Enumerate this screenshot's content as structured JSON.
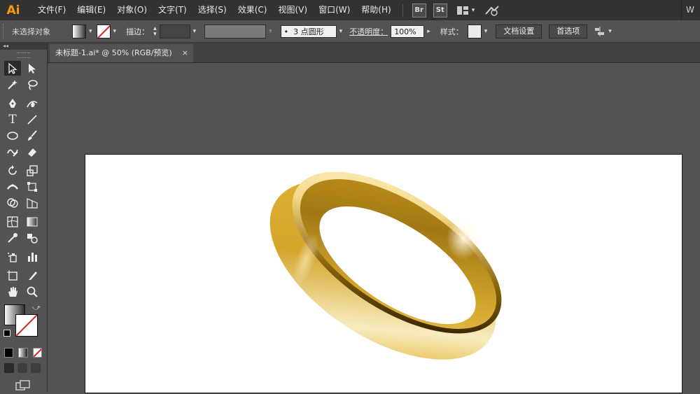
{
  "app": {
    "logo": "Ai",
    "menu": [
      "文件(F)",
      "编辑(E)",
      "对象(O)",
      "文字(T)",
      "选择(S)",
      "效果(C)",
      "视图(V)",
      "窗口(W)",
      "帮助(H)"
    ],
    "badges": [
      "Br",
      "St"
    ],
    "workspace_right": "W"
  },
  "control": {
    "selection_status": "未选择对象",
    "stroke_label": "描边：",
    "brush_label": "3 点圆形",
    "opacity_label": "不透明度：",
    "opacity_value": "100%",
    "style_label": "样式：",
    "doc_setup": "文档设置",
    "preferences": "首选项"
  },
  "toolbox": {
    "collapse_arrows": "◂◂"
  },
  "document": {
    "tab_title": "未标题-1.ai* @ 50% (RGB/预览)",
    "tab_close": "×"
  },
  "colors": {
    "accent": "#ff9a00",
    "ring_gold": "#d6a82c",
    "ring_light": "#fff3c4",
    "ring_dark": "#7a5a0a",
    "none_red": "#e02020"
  },
  "icons": {
    "selection": "selection-tool-icon",
    "direct_selection": "direct-selection-icon",
    "magic_wand": "magic-wand-icon",
    "lasso": "lasso-icon",
    "pen": "pen-icon",
    "curvature": "curvature-icon",
    "type": "type-icon",
    "line": "line-segment-icon",
    "ellipse": "ellipse-icon",
    "paintbrush": "paintbrush-icon",
    "shaper": "shaper-icon",
    "eraser": "eraser-icon",
    "rotate": "rotate-icon",
    "scale": "scale-icon",
    "width": "width-icon",
    "free_transform": "free-transform-icon",
    "shape_builder": "shape-builder-icon",
    "perspective": "perspective-grid-icon",
    "mesh": "mesh-icon",
    "gradient": "gradient-icon",
    "eyedropper": "eyedropper-icon",
    "blend": "blend-icon",
    "symbol_sprayer": "symbol-sprayer-icon",
    "column_graph": "column-graph-icon",
    "artboard": "artboard-icon",
    "slice": "slice-icon",
    "hand": "hand-icon",
    "zoom": "zoom-icon"
  }
}
